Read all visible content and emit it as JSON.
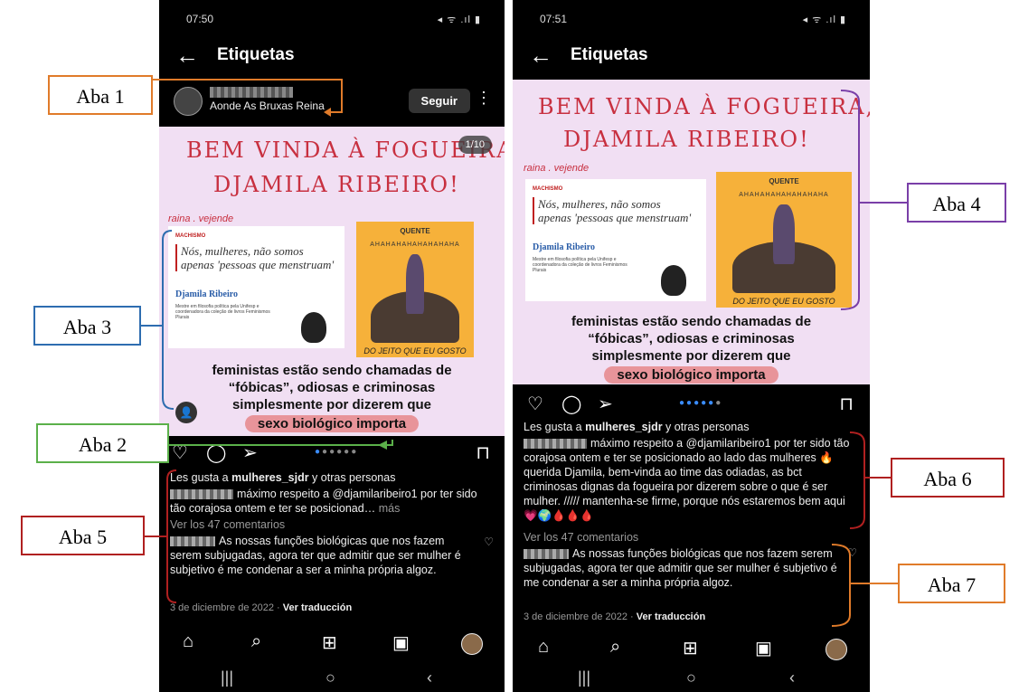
{
  "phone1": {
    "time": "07:50",
    "signal": "◂ ᯤ .ıl ▮",
    "title": "Etiquetas",
    "account_sub": "Aonde As Bruxas Reina",
    "follow_label": "Seguir",
    "counter": "1/10",
    "handwritten_line1": "BEM VINDA À FOGUEIRA,",
    "handwritten_line2": "DJAMILA RIBEIRO!",
    "handle": "raina . vejende",
    "likes": "Les gusta a mulheres_sjdr y otras personas",
    "likes_bold": "mulheres_sjdr",
    "comment_text": "máximo respeito a @djamilaribeiro1 por ter sido tão corajosa ontem e ter se posicionad…",
    "more": "más",
    "view_comments": "Ver los 47 comentarios",
    "reply_text": "As nossas funções biológicas que nos fazem serem subjugadas, agora ter que admitir que ser mulher é subjetivo é me condenar a ser a minha própria algoz.",
    "date": "3 de diciembre de 2022",
    "translate": "Ver traducción"
  },
  "phone2": {
    "time": "07:51",
    "signal": "◂ ᯤ .ıl ▮",
    "title": "Etiquetas",
    "handwritten_line1": "BEM VINDA À FOGUEIRA,",
    "handwritten_line2": "DJAMILA RIBEIRO!",
    "handle": "raina . vejende",
    "likes": "Les gusta a mulheres_sjdr y otras personas",
    "comment_text": "máximo respeito a @djamilaribeiro1 por ter sido tão corajosa ontem e ter se posicionado ao lado das mulheres 🔥 querida Djamila, bem-vinda ao time das odiadas, as bct criminosas dignas da fogueira por dizerem sobre o que é ser mulher. ///// mantenha-se firme, porque nós estaremos bem aqui 💗🌍🩸🩸🩸",
    "view_comments": "Ver los 47 comentarios",
    "reply_text": "As nossas funções biológicas que nos fazem serem subjugadas, agora ter que admitir que ser mulher é subjetivo é me condenar a ser a minha própria algoz.",
    "date": "3 de diciembre de 2022",
    "translate": "Ver traducción"
  },
  "article": {
    "tag": "MACHISMO",
    "headline": "Nós, mulheres, não somos apenas 'pessoas que menstruam'",
    "author": "Djamila Ribeiro",
    "desc": "Mestre em filosofia política pela Unifesp e coordenadora da coleção de livros Feminismos Plurais"
  },
  "illustration": {
    "top": "QUENTE",
    "laugh": "AHAHAHAHAHAHAHAHA",
    "bottom": "DO JEITO QUE EU GOSTO"
  },
  "caption": {
    "line1": "feministas estão sendo chamadas de",
    "line2": "“fóbicas”, odiosas e criminosas",
    "line3": "simplesmente por dizerem que",
    "highlight": "sexo biológico importa"
  },
  "labels": {
    "aba1": "Aba 1",
    "aba2": "Aba 2",
    "aba3": "Aba 3",
    "aba4": "Aba 4",
    "aba5": "Aba 5",
    "aba6": "Aba 6",
    "aba7": "Aba 7"
  },
  "colors": {
    "aba1": "#e07b2a",
    "aba2": "#5bb04a",
    "aba3": "#2e6db0",
    "aba4": "#7a3fa8",
    "aba5": "#b02020",
    "aba6": "#b02020",
    "aba7": "#e07b2a"
  },
  "icons": [
    "back-arrow-icon",
    "heart-icon",
    "comment-icon",
    "send-icon",
    "bookmark-icon",
    "home-icon",
    "search-icon",
    "add-icon",
    "reels-icon"
  ]
}
